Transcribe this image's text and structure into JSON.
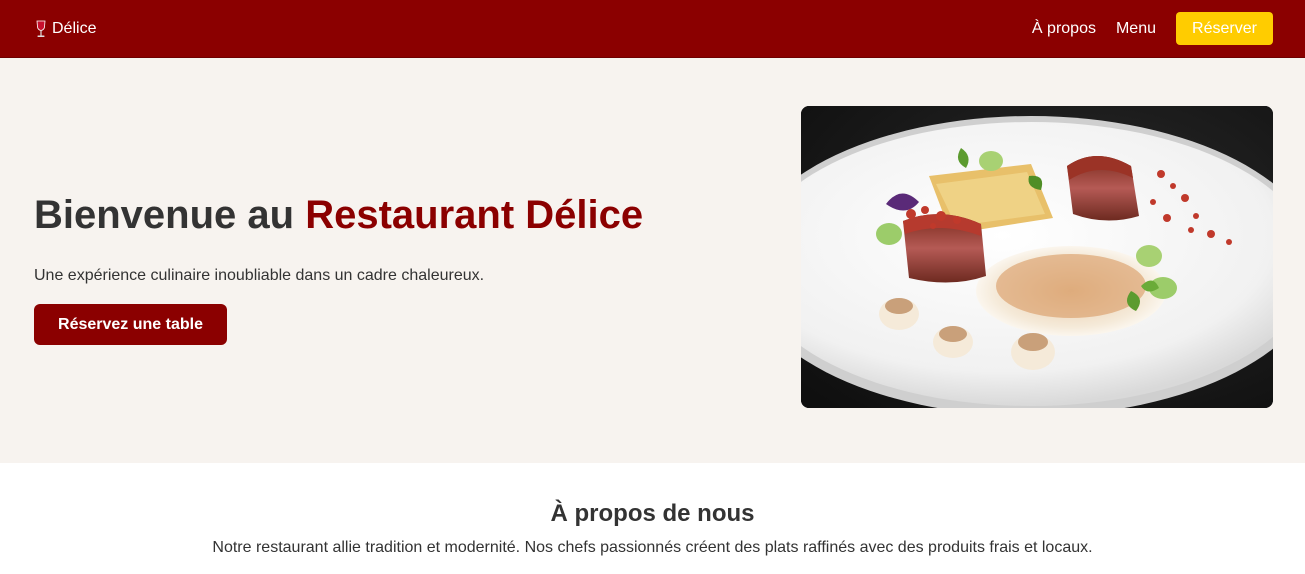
{
  "nav": {
    "brand_icon": "wine-glass-icon",
    "brand_name": "Délice",
    "links": [
      "À propos",
      "Menu"
    ],
    "cta_label": "Réserver",
    "background_color": "#8b0000",
    "cta_color": "#ffcc00"
  },
  "hero": {
    "title_prefix": "Bienvenue au ",
    "title_accent": "Restaurant Délice",
    "subtitle": "Une expérience culinaire inoubliable dans un cadre chaleureux.",
    "button_label": "Réservez une table",
    "image_alt": "Plat gastronomique de viande",
    "background_color": "#f7f3ef",
    "accent_color": "#8b0000"
  },
  "about": {
    "title": "À propos de nous",
    "text": "Notre restaurant allie tradition et modernité. Nos chefs passionnés créent des plats raffinés avec des produits frais et locaux."
  }
}
